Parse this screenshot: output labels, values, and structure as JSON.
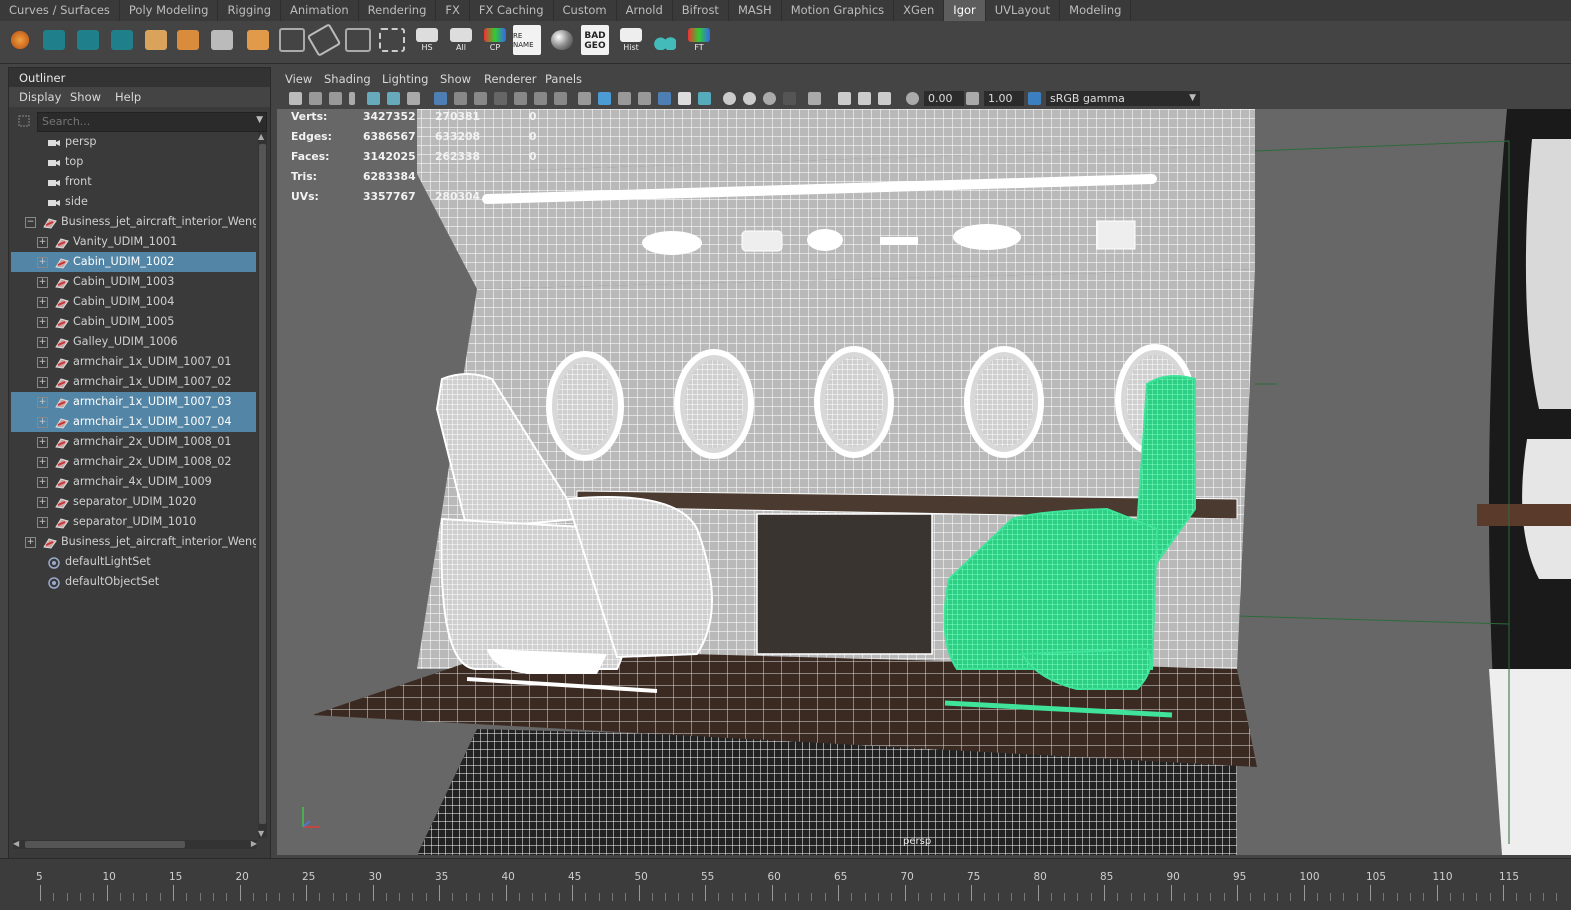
{
  "shelf": {
    "tabs": [
      "Curves / Surfaces",
      "Poly Modeling",
      "Rigging",
      "Animation",
      "Rendering",
      "FX",
      "FX Caching",
      "Custom",
      "Arnold",
      "Bifrost",
      "MASH",
      "Motion Graphics",
      "XGen",
      "Igor",
      "UVLayout",
      "Modeling"
    ],
    "active_tab": "Igor",
    "icon_labels": {
      "hs": "HS",
      "all": "All",
      "cp": "CP",
      "rename": "RE NAME",
      "badgeo": "BAD GEO",
      "hist": "Hist",
      "ft": "FT"
    }
  },
  "outliner": {
    "title": "Outliner",
    "menu": [
      "Display",
      "Show",
      "Help"
    ],
    "search_placeholder": "Search...",
    "items": [
      {
        "label": "persp",
        "kind": "camera",
        "indent": 0,
        "selected": false,
        "expander": ""
      },
      {
        "label": "top",
        "kind": "camera",
        "indent": 0,
        "selected": false,
        "expander": ""
      },
      {
        "label": "front",
        "kind": "camera",
        "indent": 0,
        "selected": false,
        "expander": ""
      },
      {
        "label": "side",
        "kind": "camera",
        "indent": 0,
        "selected": false,
        "expander": ""
      },
      {
        "label": "Business_jet_aircraft_interior_Wenge_",
        "kind": "group",
        "indent": 0,
        "selected": false,
        "expander": "−"
      },
      {
        "label": "Vanity_UDIM_1001",
        "kind": "mesh",
        "indent": 1,
        "selected": false,
        "expander": "+"
      },
      {
        "label": "Cabin_UDIM_1002",
        "kind": "mesh",
        "indent": 1,
        "selected": true,
        "expander": "+"
      },
      {
        "label": "Cabin_UDIM_1003",
        "kind": "mesh",
        "indent": 1,
        "selected": false,
        "expander": "+"
      },
      {
        "label": "Cabin_UDIM_1004",
        "kind": "mesh",
        "indent": 1,
        "selected": false,
        "expander": "+"
      },
      {
        "label": "Cabin_UDIM_1005",
        "kind": "mesh",
        "indent": 1,
        "selected": false,
        "expander": "+"
      },
      {
        "label": "Galley_UDIM_1006",
        "kind": "mesh",
        "indent": 1,
        "selected": false,
        "expander": "+"
      },
      {
        "label": "armchair_1x_UDIM_1007_01",
        "kind": "mesh",
        "indent": 1,
        "selected": false,
        "expander": "+"
      },
      {
        "label": "armchair_1x_UDIM_1007_02",
        "kind": "mesh",
        "indent": 1,
        "selected": false,
        "expander": "+"
      },
      {
        "label": "armchair_1x_UDIM_1007_03",
        "kind": "mesh",
        "indent": 1,
        "selected": true,
        "expander": "+"
      },
      {
        "label": "armchair_1x_UDIM_1007_04",
        "kind": "mesh",
        "indent": 1,
        "selected": true,
        "expander": "+"
      },
      {
        "label": "armchair_2x_UDIM_1008_01",
        "kind": "mesh",
        "indent": 1,
        "selected": false,
        "expander": "+"
      },
      {
        "label": "armchair_2x_UDIM_1008_02",
        "kind": "mesh",
        "indent": 1,
        "selected": false,
        "expander": "+"
      },
      {
        "label": "armchair_4x_UDIM_1009",
        "kind": "mesh",
        "indent": 1,
        "selected": false,
        "expander": "+"
      },
      {
        "label": "separator_UDIM_1020",
        "kind": "mesh",
        "indent": 1,
        "selected": false,
        "expander": "+"
      },
      {
        "label": "separator_UDIM_1010",
        "kind": "mesh",
        "indent": 1,
        "selected": false,
        "expander": "+"
      },
      {
        "label": "Business_jet_aircraft_interior_Wenge_",
        "kind": "group",
        "indent": 0,
        "selected": false,
        "expander": "+"
      },
      {
        "label": "defaultLightSet",
        "kind": "set",
        "indent": 0,
        "selected": false,
        "expander": ""
      },
      {
        "label": "defaultObjectSet",
        "kind": "set",
        "indent": 0,
        "selected": false,
        "expander": ""
      }
    ]
  },
  "viewport": {
    "menu": [
      "View",
      "Shading",
      "Lighting",
      "Show",
      "Renderer",
      "Panels"
    ],
    "exposure": "0.00",
    "gamma": "1.00",
    "color_space": "sRGB gamma",
    "camera_label": "persp",
    "hud": [
      {
        "label": "Verts:",
        "value": "3427352",
        "sel": "270381",
        "extra": "0"
      },
      {
        "label": "Edges:",
        "value": "6386567",
        "sel": "633208",
        "extra": "0"
      },
      {
        "label": "Faces:",
        "value": "3142025",
        "sel": "262338",
        "extra": "0"
      },
      {
        "label": "Tris:",
        "value": "6283384",
        "sel": "",
        "extra": ""
      },
      {
        "label": "UVs:",
        "value": "3357767",
        "sel": "280304",
        "extra": ""
      }
    ],
    "colors": {
      "wire": "#f4f4f4",
      "selected": "#3fe39a",
      "floor": "#3a2a22"
    }
  },
  "timeline": {
    "ticks": [
      "5",
      "10",
      "15",
      "20",
      "25",
      "30",
      "35",
      "40",
      "45",
      "50",
      "55",
      "60",
      "65",
      "70",
      "75",
      "80",
      "85",
      "90",
      "95",
      "100",
      "105",
      "110",
      "115"
    ]
  }
}
